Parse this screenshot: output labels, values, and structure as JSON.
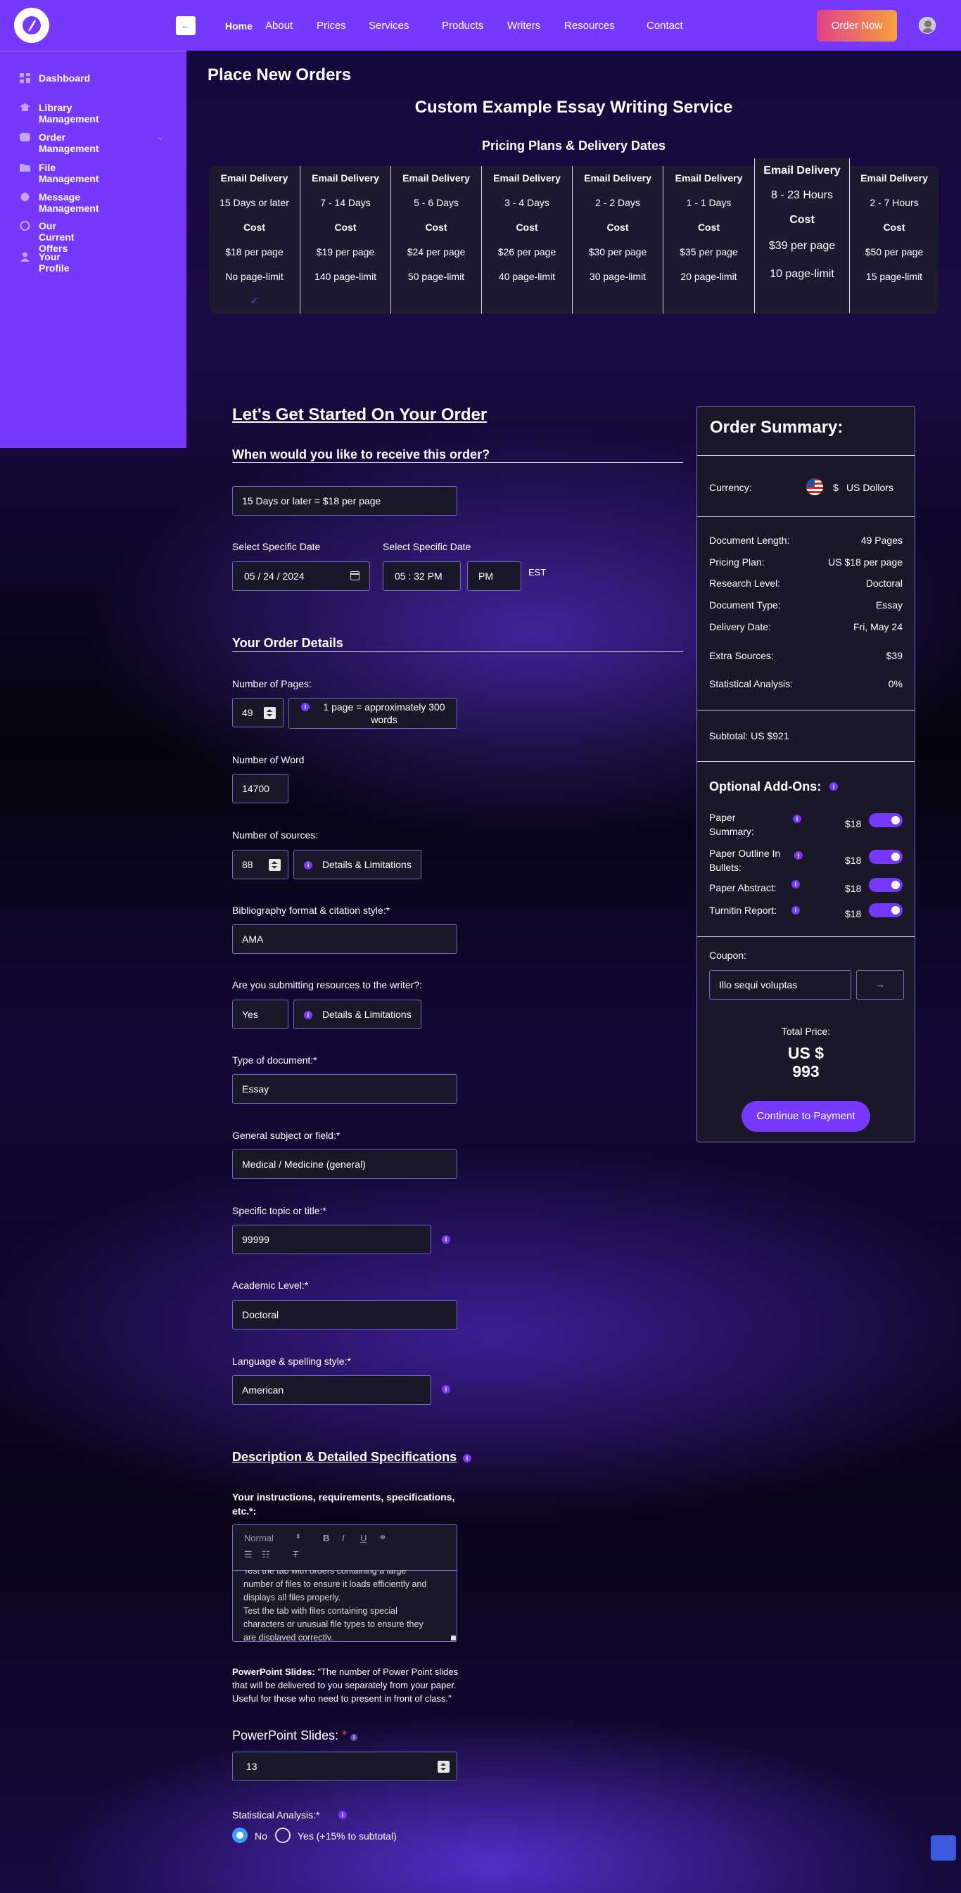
{
  "nav": {
    "home": "Home",
    "about": "About",
    "prices": "Prices",
    "services": "Services",
    "products": "Products",
    "writers": "Writers",
    "resources": "Resources",
    "contact": "Contact",
    "order_now": "Order Now",
    "back_arrow": "←"
  },
  "sidebar": {
    "items": [
      {
        "label": "Dashboard",
        "icon": "dashboard-icon"
      },
      {
        "label": "Library Management",
        "icon": "graduation-cap-icon"
      },
      {
        "label": "Order Management",
        "icon": "database-icon"
      },
      {
        "label": "File Management",
        "icon": "folder-icon"
      },
      {
        "label": "Message Management",
        "icon": "message-icon"
      },
      {
        "label": "Our Current Offers",
        "icon": "offers-icon"
      },
      {
        "label": "Your Profile",
        "icon": "user-icon"
      }
    ]
  },
  "page": {
    "title": "Place New Orders",
    "service_title": "Custom Example Essay Writing Service",
    "pricing_title": "Pricing Plans & Delivery Dates"
  },
  "plans": [
    {
      "delivery": "Email Delivery",
      "time": "15 Days or later",
      "cost_label": "Cost",
      "price": "$18 per page",
      "limit": "No page-limit"
    },
    {
      "delivery": "Email Delivery",
      "time": "7 - 14 Days",
      "cost_label": "Cost",
      "price": "$19 per page",
      "limit": "140 page-limit"
    },
    {
      "delivery": "Email Delivery",
      "time": "5 - 6 Days",
      "cost_label": "Cost",
      "price": "$24 per page",
      "limit": "50 page-limit"
    },
    {
      "delivery": "Email Delivery",
      "time": "3 - 4 Days",
      "cost_label": "Cost",
      "price": "$26 per page",
      "limit": "40 page-limit"
    },
    {
      "delivery": "Email Delivery",
      "time": "2 - 2 Days",
      "cost_label": "Cost",
      "price": "$30 per page",
      "limit": "30 page-limit"
    },
    {
      "delivery": "Email Delivery",
      "time": "1 - 1 Days",
      "cost_label": "Cost",
      "price": "$35 per page",
      "limit": "20 page-limit"
    },
    {
      "delivery": "Email Delivery",
      "time": "8 - 23 Hours",
      "cost_label": "Cost",
      "price": "$39 per page",
      "limit": "10 page-limit"
    },
    {
      "delivery": "Email Delivery",
      "time": "2 - 7 Hours",
      "cost_label": "Cost",
      "price": "$50 per page",
      "limit": "15 page-limit"
    }
  ],
  "form": {
    "heading": "Let's Get Started On Your Order",
    "delivery_question": "When would you like to receive this order?",
    "delivery_value": "15 Days or later = $18 per page",
    "date_label": "Select Specific Date",
    "date_value": "05 / 24 / 2024",
    "time_label": "Select Specific Date",
    "time_value": "05 : 32  PM",
    "ampm_value": "PM",
    "timezone": "EST",
    "details_heading": "Your Order Details",
    "pages_label": "Number of Pages:",
    "pages_value": "49",
    "pages_note": "1 page = approximately 300 words",
    "words_label": "Number of Word",
    "words_value": "14700",
    "sources_label": "Number of sources:",
    "sources_value": "88",
    "details_limits": "Details & Limitations",
    "citation_label": "Bibliography format & citation style:*",
    "citation_value": "AMA",
    "resources_label": "Are you submitting resources to the writer?:",
    "resources_value": "Yes",
    "doc_type_label": "Type of document:*",
    "doc_type_value": "Essay",
    "subject_label": "General subject or field:*",
    "subject_value": "Medical / Medicine (general)",
    "topic_label": "Specific topic or title:*",
    "topic_value": "99999",
    "academic_label": "Academic Level:*",
    "academic_value": "Doctoral",
    "language_label": "Language & spelling style:*",
    "language_value": "American",
    "description_heading": "Description & Detailed Specifications",
    "instructions_label": "Your instructions, requirements, specifications, etc.*:",
    "editor_format": "Normal",
    "editor_text": [
      "Test the tab with orders containing a large",
      "number of files to ensure it loads efficiently and",
      "displays all files properly.",
      "Test the tab with files containing special",
      "characters or unusual file types to ensure they",
      "are displayed correctly."
    ],
    "ppt_title": "PowerPoint Slides:",
    "ppt_desc": "\"The number of Power Point slides that will be delivered to you separately from your paper. Useful for those who need to present in front of class.\"",
    "ppt_label": "PowerPoint Slides:",
    "ppt_required": "*",
    "ppt_value": "13",
    "stat_label": "Statistical Analysis:*",
    "stat_no": "No",
    "stat_yes": "Yes (+15% to subtotal)"
  },
  "summary": {
    "title": "Order Summary:",
    "currency_label": "Currency:",
    "currency_symbol": "$",
    "currency_name": "US Dollors",
    "rows": [
      {
        "label": "Document Length:",
        "value": "49 Pages"
      },
      {
        "label": "Pricing Plan:",
        "value": "US $18 per page"
      },
      {
        "label": "Research Level:",
        "value": "Doctoral"
      },
      {
        "label": "Document Type:",
        "value": "Essay"
      },
      {
        "label": "Delivery Date:",
        "value": "Fri, May 24"
      }
    ],
    "extra_sources_label": "Extra Sources:",
    "extra_sources_value": "$39",
    "stat_label": "Statistical Analysis:",
    "stat_value": "0%",
    "subtotal": "Subtotal: US $921",
    "addons_title": "Optional Add-Ons:",
    "addons": [
      {
        "label_1": "Paper",
        "label_2": "Summary:",
        "price": "$18"
      },
      {
        "label_1": "Paper Outline In",
        "label_2": "Bullets:",
        "price": "$18"
      },
      {
        "label_1": "Paper Abstract:",
        "label_2": "",
        "price": "$18"
      },
      {
        "label_1": "Turnitin Report:",
        "label_2": "",
        "price": "$18"
      }
    ],
    "coupon_label": "Coupon:",
    "coupon_value": "Illo sequi voluptas",
    "coupon_arrow": "→",
    "total_label": "Total Price:",
    "total_currency": "US $",
    "total_value": "993",
    "pay_button": "Continue to Payment"
  }
}
